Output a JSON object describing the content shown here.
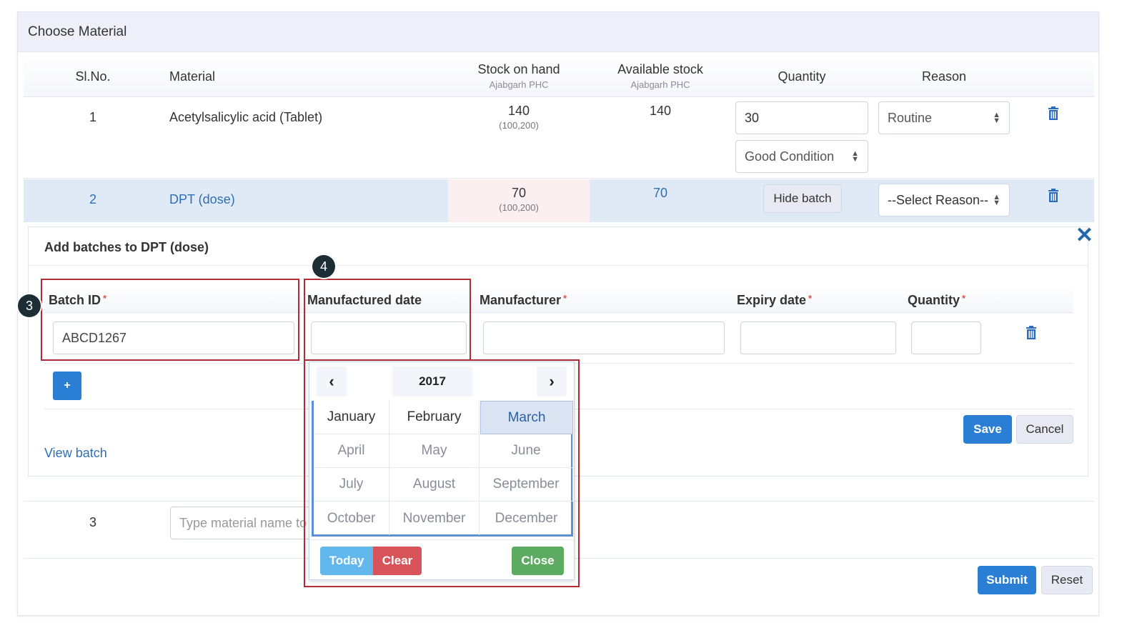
{
  "panel": {
    "title": "Choose Material"
  },
  "table": {
    "headers": {
      "slno": "Sl.No.",
      "material": "Material",
      "stock_on_hand": "Stock on hand",
      "stock_on_hand_sub": "Ajabgarh PHC",
      "available_stock": "Available stock",
      "available_stock_sub": "Ajabgarh PHC",
      "quantity": "Quantity",
      "reason": "Reason"
    },
    "rows": [
      {
        "slno": "1",
        "material": "Acetylsalicylic acid (Tablet)",
        "stock": "140",
        "stock_range": "(100,200)",
        "available": "140",
        "quantity": "30",
        "reason": "Routine",
        "condition": "Good Condition"
      },
      {
        "slno": "2",
        "material": "DPT (dose)",
        "stock": "70",
        "stock_range": "(100,200)",
        "available": "70",
        "hide_batch_label": "Hide batch",
        "reason": "--Select Reason--"
      },
      {
        "slno": "3",
        "material_placeholder": "Type material name to"
      }
    ]
  },
  "batch": {
    "title": "Add batches to DPT (dose)",
    "headers": {
      "batch_id": "Batch ID",
      "manufactured_date": "Manufactured date",
      "manufacturer": "Manufacturer",
      "expiry_date": "Expiry date",
      "quantity": "Quantity"
    },
    "required_mark": "*",
    "batch_id_value": "ABCD1267",
    "add_label": "+",
    "view_batch_label": "View batch",
    "save_label": "Save",
    "cancel_label": "Cancel"
  },
  "datepicker": {
    "year": "2017",
    "months": [
      "January",
      "February",
      "March",
      "April",
      "May",
      "June",
      "July",
      "August",
      "September",
      "October",
      "November",
      "December"
    ],
    "selected": "March",
    "today_label": "Today",
    "clear_label": "Clear",
    "close_label": "Close"
  },
  "annotations": {
    "badge3": "3",
    "badge4": "4"
  },
  "footer": {
    "submit_label": "Submit",
    "reset_label": "Reset"
  },
  "colors": {
    "primary": "#2a7fd4",
    "highlight_row": "#dfeaf6",
    "annotation_box": "#b22b35",
    "today": "#62b7ec",
    "clear": "#d9535a",
    "close": "#5cab61"
  }
}
